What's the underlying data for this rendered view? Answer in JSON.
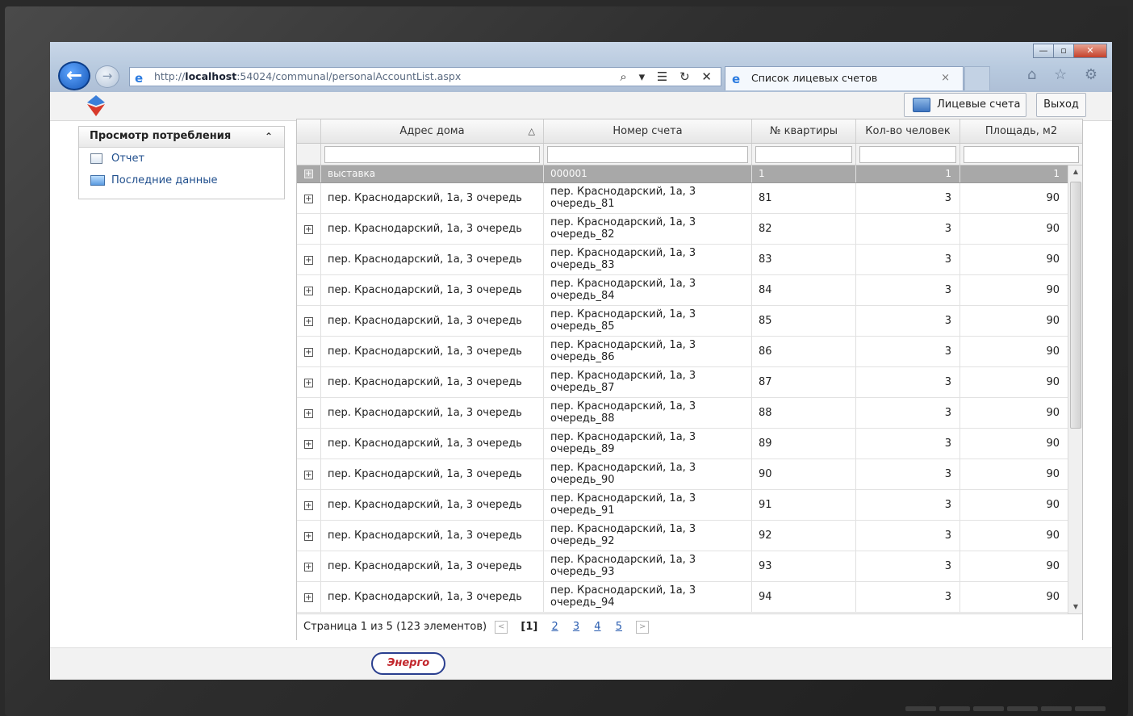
{
  "browser": {
    "url_prefix": "http://",
    "url_host": "localhost",
    "url_rest": ":54024/communal/personalAccountList.aspx",
    "tab_title": "Список лицевых счетов",
    "tab_close": "×",
    "back_glyph": "←",
    "forward_glyph": "→",
    "addr_tools": "⌕ ▾ ☰ ↻ ✕",
    "right_tools": "⌂ ☆ ⚙",
    "win_minimize": "—",
    "win_maximize": "▫",
    "win_close": "✕"
  },
  "header": {
    "accounts_button": "Лицевые счета",
    "exit_button": "Выход"
  },
  "sidebar": {
    "title": "Просмотр потребления",
    "collapse_glyph": "⌃",
    "items": [
      {
        "label": "Отчет",
        "icon": "document-icon"
      },
      {
        "label": "Последние данные",
        "icon": "data-icon"
      }
    ]
  },
  "grid": {
    "columns": [
      "Адрес дома",
      "Номер счета",
      "№ квартиры",
      "Кол-во человек",
      "Площадь, м2"
    ],
    "sort_glyph": "△",
    "expand_glyph": "+",
    "group_row": {
      "address": "выставка",
      "account": "000001",
      "apartment": "1",
      "people": "1",
      "area": "1"
    },
    "rows": [
      {
        "address": "пер. Краснодарский, 1а, 3 очередь",
        "account": "пер. Краснодарский, 1а, 3 очередь_81",
        "apartment": "81",
        "people": "3",
        "area": "90"
      },
      {
        "address": "пер. Краснодарский, 1а, 3 очередь",
        "account": "пер. Краснодарский, 1а, 3 очередь_82",
        "apartment": "82",
        "people": "3",
        "area": "90"
      },
      {
        "address": "пер. Краснодарский, 1а, 3 очередь",
        "account": "пер. Краснодарский, 1а, 3 очередь_83",
        "apartment": "83",
        "people": "3",
        "area": "90"
      },
      {
        "address": "пер. Краснодарский, 1а, 3 очередь",
        "account": "пер. Краснодарский, 1а, 3 очередь_84",
        "apartment": "84",
        "people": "3",
        "area": "90"
      },
      {
        "address": "пер. Краснодарский, 1а, 3 очередь",
        "account": "пер. Краснодарский, 1а, 3 очередь_85",
        "apartment": "85",
        "people": "3",
        "area": "90"
      },
      {
        "address": "пер. Краснодарский, 1а, 3 очередь",
        "account": "пер. Краснодарский, 1а, 3 очередь_86",
        "apartment": "86",
        "people": "3",
        "area": "90"
      },
      {
        "address": "пер. Краснодарский, 1а, 3 очередь",
        "account": "пер. Краснодарский, 1а, 3 очередь_87",
        "apartment": "87",
        "people": "3",
        "area": "90"
      },
      {
        "address": "пер. Краснодарский, 1а, 3 очередь",
        "account": "пер. Краснодарский, 1а, 3 очередь_88",
        "apartment": "88",
        "people": "3",
        "area": "90"
      },
      {
        "address": "пер. Краснодарский, 1а, 3 очередь",
        "account": "пер. Краснодарский, 1а, 3 очередь_89",
        "apartment": "89",
        "people": "3",
        "area": "90"
      },
      {
        "address": "пер. Краснодарский, 1а, 3 очередь",
        "account": "пер. Краснодарский, 1а, 3 очередь_90",
        "apartment": "90",
        "people": "3",
        "area": "90"
      },
      {
        "address": "пер. Краснодарский, 1а, 3 очередь",
        "account": "пер. Краснодарский, 1а, 3 очередь_91",
        "apartment": "91",
        "people": "3",
        "area": "90"
      },
      {
        "address": "пер. Краснодарский, 1а, 3 очередь",
        "account": "пер. Краснодарский, 1а, 3 очередь_92",
        "apartment": "92",
        "people": "3",
        "area": "90"
      },
      {
        "address": "пер. Краснодарский, 1а, 3 очередь",
        "account": "пер. Краснодарский, 1а, 3 очередь_93",
        "apartment": "93",
        "people": "3",
        "area": "90"
      },
      {
        "address": "пер. Краснодарский, 1а, 3 очередь",
        "account": "пер. Краснодарский, 1а, 3 очередь_94",
        "apartment": "94",
        "people": "3",
        "area": "90"
      }
    ],
    "scroll_up": "▲",
    "scroll_down": "▼"
  },
  "pager": {
    "summary": "Страница 1 из 5 (123 элементов)",
    "prev_glyph": "<",
    "current": "[1]",
    "pages": [
      "2",
      "3",
      "4",
      "5"
    ],
    "next_glyph": ">"
  },
  "footer": {
    "logo_text": "Энерго"
  },
  "colors": {
    "group_row_bg": "#a8a8a8",
    "link": "#1f4e8c",
    "pager_link": "#2a5db0"
  }
}
